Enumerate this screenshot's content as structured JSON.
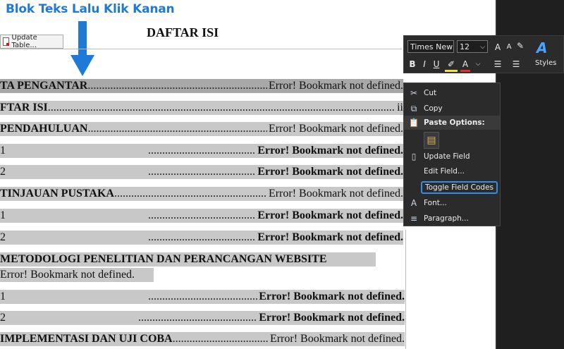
{
  "caption": "Blok Teks Lalu Klik Kanan",
  "update_button": {
    "label": "Update Table..."
  },
  "doc_title": "DAFTAR ISI",
  "toc": [
    {
      "title": "TA PENGANTAR ",
      "entry": "Error! Bookmark not defined.",
      "entry_bold": false,
      "dark": true
    },
    {
      "title": "FTAR ISI ",
      "entry": "ii",
      "entry_bold": false,
      "dark": false
    },
    {
      "title": "PENDAHULUAN",
      "entry": "Error! Bookmark not defined.",
      "entry_bold": false,
      "dark": false
    },
    {
      "title": "1",
      "entry": "Error! Bookmark not defined.",
      "entry_bold": true,
      "dark": false,
      "indent": true
    },
    {
      "title": "2",
      "entry": "Error! Bookmark not defined.",
      "entry_bold": true,
      "dark": false,
      "indent": true
    },
    {
      "title": "TINJAUAN PUSTAKA ",
      "entry": "Error! Bookmark not defined.",
      "entry_bold": false,
      "dark": false
    },
    {
      "title": "1",
      "entry": "Error! Bookmark not defined.",
      "entry_bold": true,
      "dark": false,
      "indent": true
    },
    {
      "title": "2",
      "entry": "Error! Bookmark not defined.",
      "entry_bold": true,
      "dark": false,
      "indent": true
    }
  ],
  "metodologi": {
    "title": "METODOLOGI PENELITIAN DAN PERANCANGAN WEBSITE",
    "entry": "Error! Bookmark not defined."
  },
  "toc2": [
    {
      "title": "1",
      "entry": "Error! Bookmark not defined."
    },
    {
      "title": "2",
      "entry": "Error! Bookmark not defined."
    },
    {
      "title": "IMPLEMENTASI DAN UJI COBA ",
      "entry": "Error! Bookmark not defined."
    }
  ],
  "mini_toolbar": {
    "font": "Times New Roman",
    "size": "12",
    "grow": "A",
    "shrink": "A",
    "bold": "B",
    "italic": "I",
    "underline": "U",
    "font_color": "A",
    "styles_label": "Styles",
    "styles_icon": "A"
  },
  "context_menu": {
    "cut": "Cut",
    "copy": "Copy",
    "paste_options": "Paste Options:",
    "update_field": "Update Field",
    "edit_field": "Edit Field...",
    "toggle_field_codes": "Toggle Field Codes",
    "font": "Font...",
    "paragraph": "Paragraph..."
  }
}
